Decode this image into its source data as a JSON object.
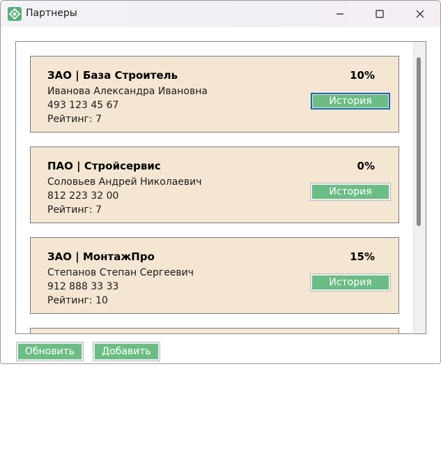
{
  "window": {
    "title": "Партнеры",
    "app_icon": "partners-app-icon"
  },
  "partners": [
    {
      "name": "ЗАО | База Строитель",
      "discount": "10%",
      "director": "Иванова Александра Ивановна",
      "phone": "493 123 45 67",
      "rating_label": "Рейтинг:",
      "rating": "7",
      "history_label": "История"
    },
    {
      "name": "ПАО | Стройсервис",
      "discount": "0%",
      "director": "Соловьев Андрей Николаевич",
      "phone": "812 223 32 00",
      "rating_label": "Рейтинг:",
      "rating": "7",
      "history_label": "История"
    },
    {
      "name": "ЗАО | МонтажПро",
      "discount": "15%",
      "director": "Степанов Степан Сергеевич",
      "phone": "912 888 33 33",
      "rating_label": "Рейтинг:",
      "rating": "10",
      "history_label": "История"
    }
  ],
  "actions": {
    "refresh_label": "Обновить",
    "add_label": "Добавить"
  },
  "colors": {
    "card_background": "#f4e6d2",
    "button_green": "#6cbd85",
    "focus_border": "#1b67a7"
  }
}
